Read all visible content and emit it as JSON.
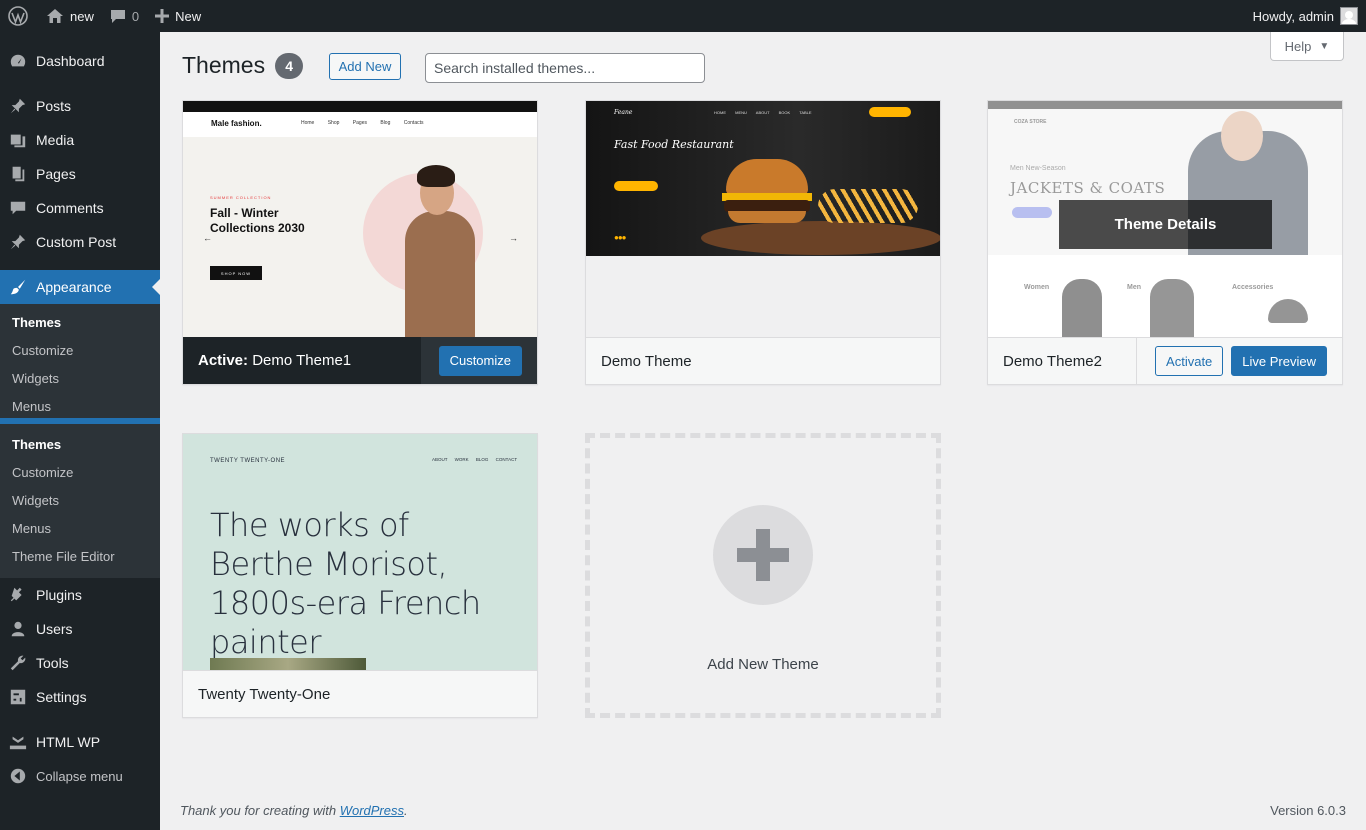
{
  "adminbar": {
    "site_name": "new",
    "comments_count": "0",
    "new_label": "New",
    "howdy": "Howdy, admin"
  },
  "sidebar": {
    "dashboard": "Dashboard",
    "posts": "Posts",
    "media": "Media",
    "pages": "Pages",
    "comments": "Comments",
    "custom_post": "Custom Post",
    "appearance": "Appearance",
    "submenu": [
      "Themes",
      "Customize",
      "Widgets",
      "Menus",
      "Theme File Editor"
    ],
    "plugins": "Plugins",
    "users": "Users",
    "tools": "Tools",
    "settings": "Settings",
    "html_wp": "HTML WP",
    "collapse": "Collapse menu"
  },
  "header": {
    "title": "Themes",
    "count": "4",
    "add_new": "Add New",
    "search_placeholder": "Search installed themes...",
    "help": "Help"
  },
  "themes": [
    {
      "active_prefix": "Active:",
      "name": "Demo Theme1",
      "action": "Customize",
      "preview": {
        "logo": "Male fashion.",
        "nav": "Home Shop Pages Blog Contacts",
        "tag": "SUMMER COLLECTION",
        "headline": "Fall - Winter Collections 2030",
        "cta": "SHOP NOW"
      }
    },
    {
      "name": "Demo Theme",
      "preview": {
        "logo": "Feane",
        "nav": "HOME MENU ABOUT BOOK TABLE",
        "headline": "Fast Food Restaurant"
      }
    },
    {
      "name": "Demo Theme2",
      "overlay": "Theme Details",
      "action_secondary": "Activate",
      "action_primary": "Live Preview",
      "preview": {
        "logo": "COZA STORE",
        "subline": "Men New-Season",
        "headline": "JACKETS & COATS",
        "categories": [
          "Women",
          "Men",
          "Accessories"
        ]
      }
    },
    {
      "name": "Twenty Twenty-One",
      "preview": {
        "site": "TWENTY TWENTY-ONE",
        "nav": "ABOUT WORK BLOG CONTACT",
        "headline": "The works of Berthe Morisot, 1800s-era French painter"
      }
    }
  ],
  "add_new_theme": "Add New Theme",
  "footer": {
    "thanks_prefix": "Thank you for creating with ",
    "thanks_link": "WordPress",
    "thanks_suffix": ".",
    "version": "Version 6.0.3"
  }
}
